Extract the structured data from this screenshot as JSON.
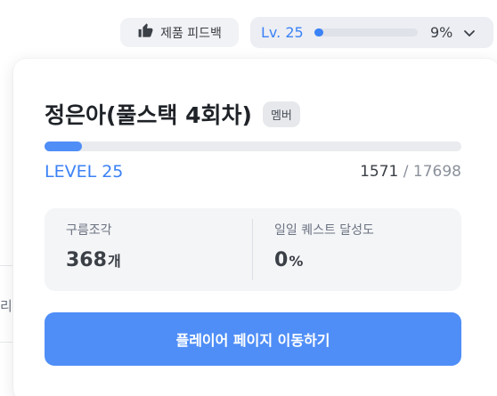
{
  "topbar": {
    "feedback_label": "제품 피드백",
    "level_short": "Lv. 25",
    "progress_percent": 9,
    "progress_text": "9%"
  },
  "profile": {
    "name": "정은아(풀스택 4회차)",
    "role_badge": "멤버",
    "level_label": "LEVEL 25",
    "xp_current": "1571",
    "xp_separator": " / ",
    "xp_max": "17698",
    "xp_fraction": 0.0888
  },
  "stats": {
    "cloud_label": "구름조각",
    "cloud_value": "368",
    "cloud_unit": "개",
    "quest_label": "일일 퀘스트 달성도",
    "quest_value": "0",
    "quest_unit": "%"
  },
  "actions": {
    "player_page_label": "플레이어 페이지 이동하기"
  },
  "background": {
    "fragment_text": "리"
  },
  "colors": {
    "accent": "#3b82f6",
    "button": "#4f8ef7"
  },
  "icons": {
    "feedback": "thumbs-up-icon",
    "dropdown": "chevron-down-icon"
  }
}
